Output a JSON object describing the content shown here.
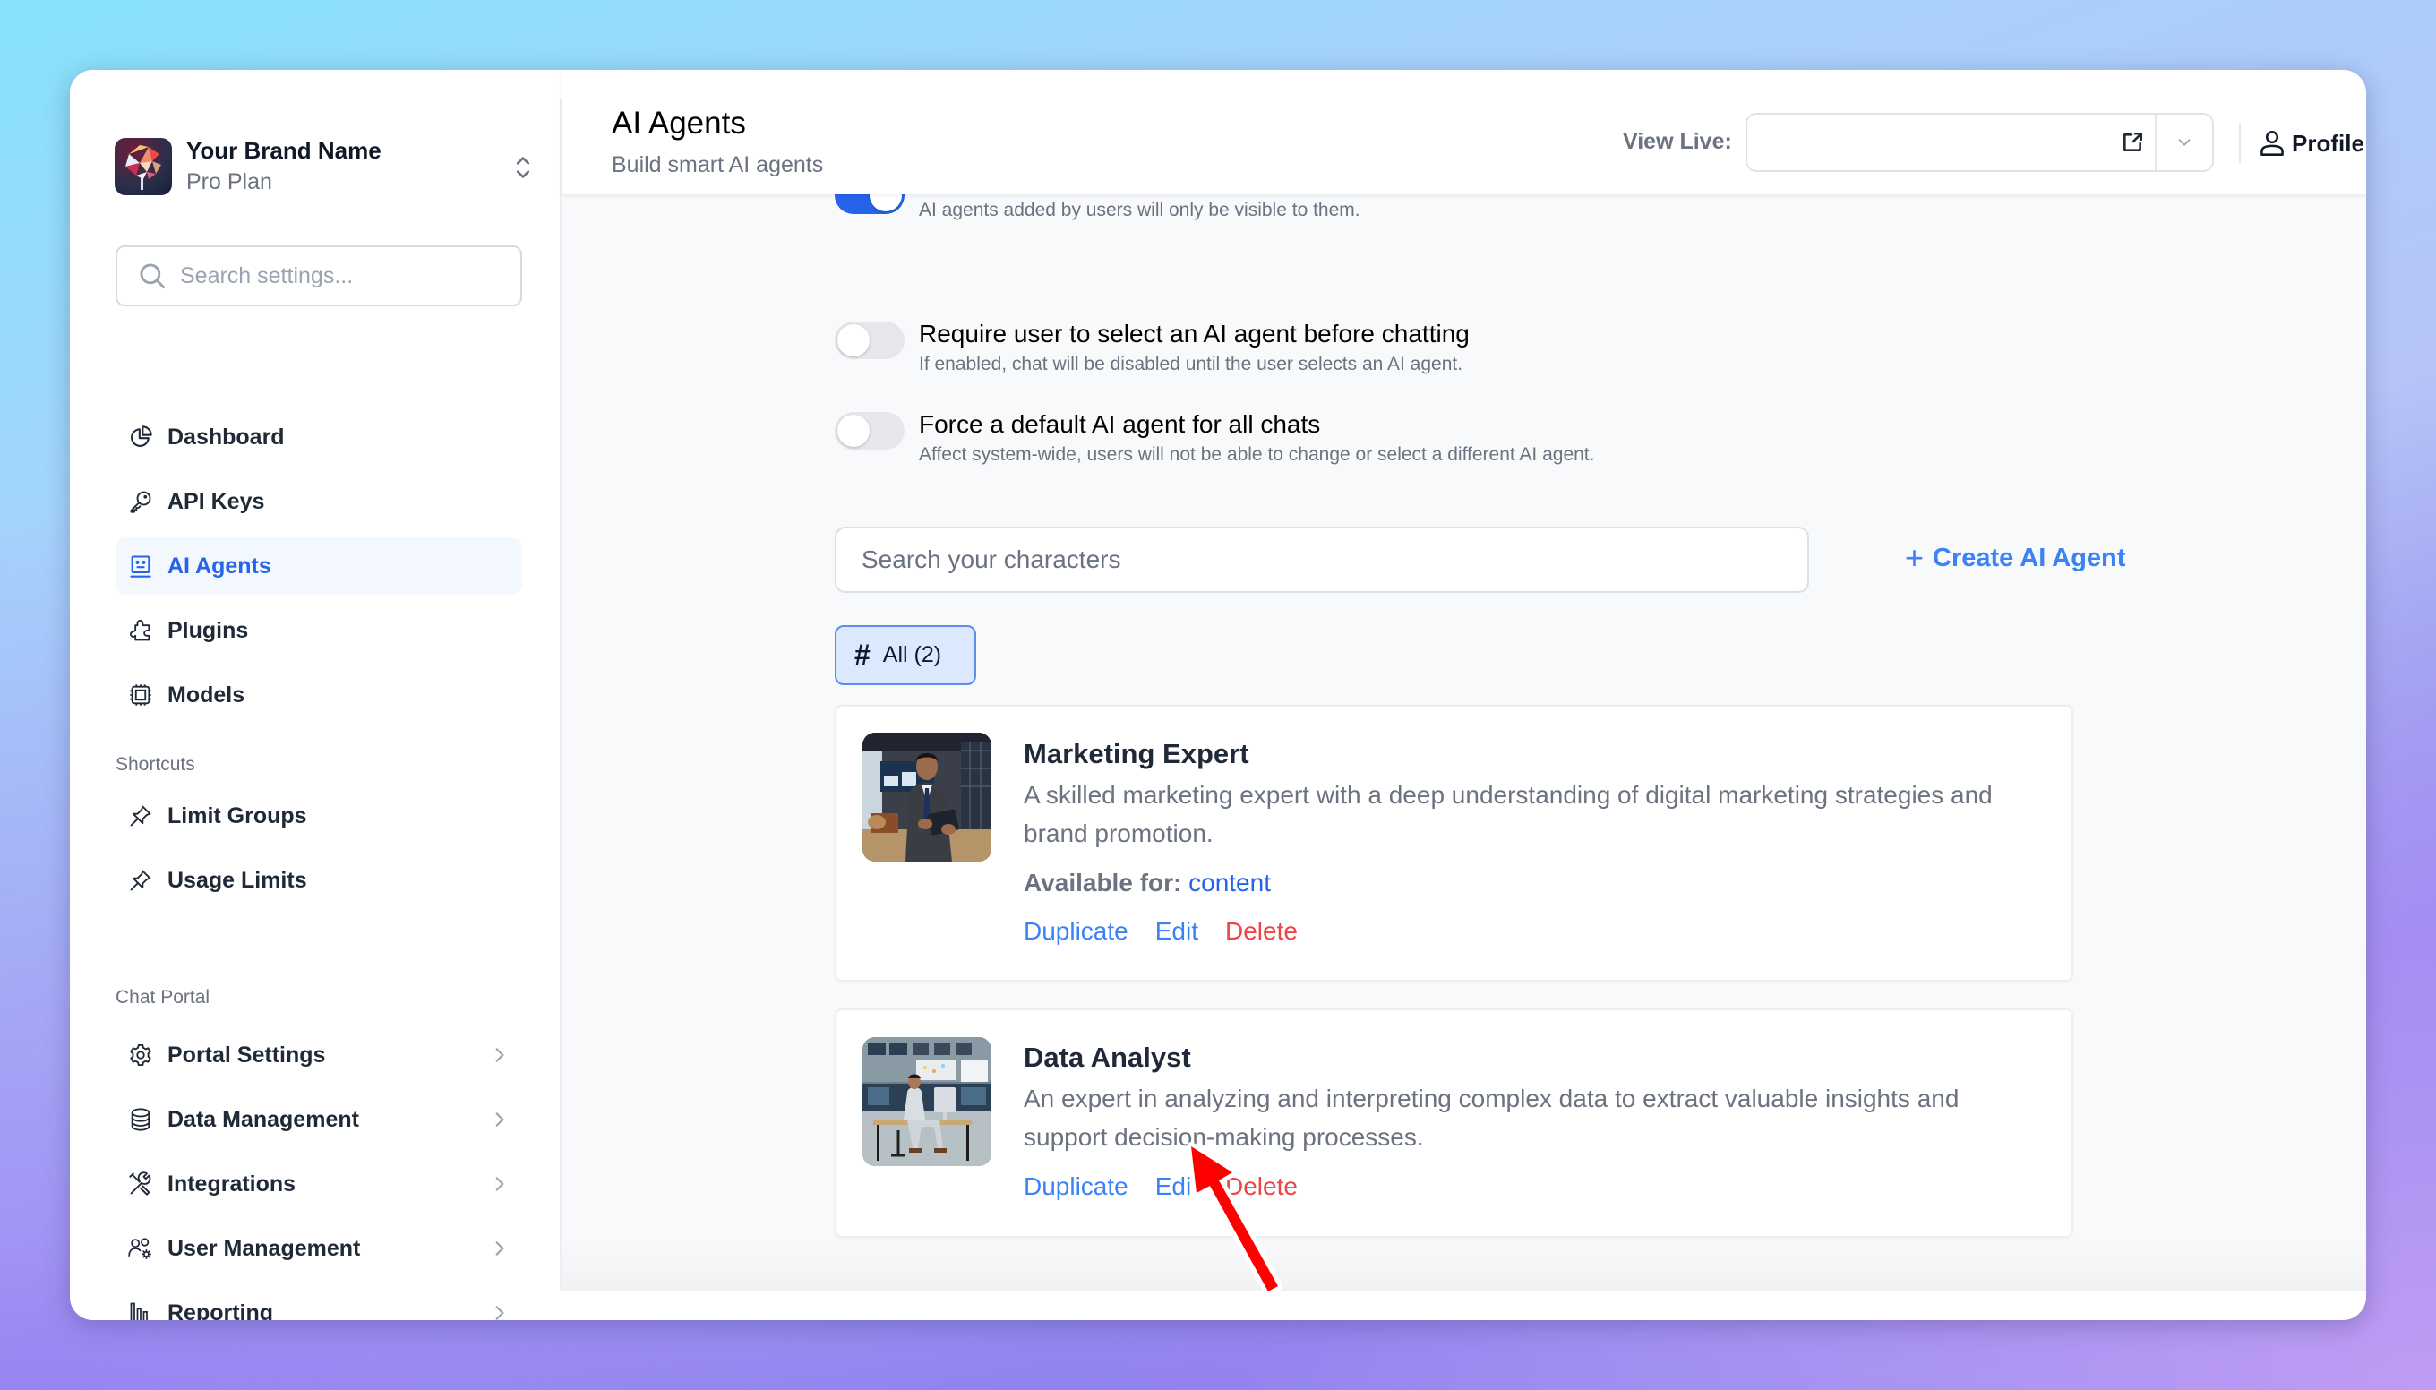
{
  "brand": {
    "name": "Your Brand Name",
    "plan": "Pro Plan",
    "logo_icon": "brain-icon",
    "switch_icon": "chevron-up-down-icon"
  },
  "sidebar": {
    "search_placeholder": "Search settings...",
    "main_items": [
      {
        "label": "Dashboard",
        "icon": "pie-chart-icon",
        "active": false
      },
      {
        "label": "API Keys",
        "icon": "key-icon",
        "active": false
      },
      {
        "label": "AI Agents",
        "icon": "robot-face-icon",
        "active": true
      },
      {
        "label": "Plugins",
        "icon": "puzzle-icon",
        "active": false
      },
      {
        "label": "Models",
        "icon": "cpu-chip-icon",
        "active": false
      }
    ],
    "shortcuts_label": "Shortcuts",
    "shortcuts": [
      {
        "label": "Limit Groups",
        "icon": "pin-icon"
      },
      {
        "label": "Usage Limits",
        "icon": "pin-icon"
      }
    ],
    "chat_portal_label": "Chat Portal",
    "chat_portal_items": [
      {
        "label": "Portal Settings",
        "icon": "gear-icon"
      },
      {
        "label": "Data Management",
        "icon": "database-icon"
      },
      {
        "label": "Integrations",
        "icon": "wrench-screwdriver-icon"
      },
      {
        "label": "User Management",
        "icon": "users-gear-icon"
      },
      {
        "label": "Reporting",
        "icon": "bar-chart-icon"
      }
    ]
  },
  "header": {
    "title": "AI Agents",
    "subtitle": "Build smart AI agents",
    "view_live_label": "View Live:",
    "view_live_value": "",
    "profile_label": "Profile"
  },
  "settings": {
    "partial_toggle": {
      "description": "AI agents added by users will only be visible to them.",
      "on": true
    },
    "toggles": [
      {
        "title": "Require user to select an AI agent before chatting",
        "description": "If enabled, chat will be disabled until the user selects an AI agent.",
        "on": false
      },
      {
        "title": "Force a default AI agent for all chats",
        "description": "Affect system-wide, users will not be able to change or select a different AI agent.",
        "on": false
      }
    ]
  },
  "agents": {
    "search_placeholder": "Search your characters",
    "create_label": "Create AI Agent",
    "filter_label": "All (2)",
    "list": [
      {
        "name": "Marketing Expert",
        "description": "A skilled marketing expert with a deep understanding of digital marketing strategies and brand promotion.",
        "available_label": "Available for:",
        "available_value": "content",
        "actions": {
          "duplicate": "Duplicate",
          "edit": "Edit",
          "delete": "Delete"
        }
      },
      {
        "name": "Data Analyst",
        "description": "An expert in analyzing and interpreting complex data to extract valuable insights and support decision-making processes.",
        "actions": {
          "duplicate": "Duplicate",
          "edit": "Edit",
          "delete": "Delete"
        }
      }
    ]
  },
  "annotation": {
    "arrow_color": "#ff0000",
    "target": "Edit"
  },
  "colors": {
    "accent": "#2563eb",
    "link": "#3b82f6",
    "danger": "#ef4444"
  }
}
